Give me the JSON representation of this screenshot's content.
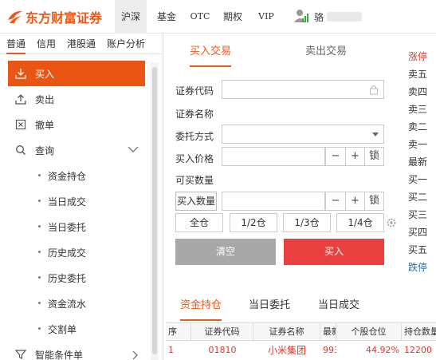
{
  "header": {
    "brand": "东方财富证券",
    "nav": [
      {
        "label": "沪深",
        "active": true
      },
      {
        "label": "基金",
        "active": false
      },
      {
        "label": "OTC",
        "active": false
      },
      {
        "label": "期权",
        "active": false
      },
      {
        "label": "VIP",
        "active": false
      }
    ],
    "user_name": "骆"
  },
  "sidebar": {
    "tabs": [
      {
        "label": "普通",
        "active": true
      },
      {
        "label": "信用",
        "active": false
      },
      {
        "label": "港股通",
        "active": false
      },
      {
        "label": "账户分析",
        "active": false
      }
    ],
    "menu": [
      {
        "label": "买入",
        "icon": "download-icon",
        "active": true
      },
      {
        "label": "卖出",
        "icon": "upload-icon",
        "active": false
      },
      {
        "label": "撤单",
        "icon": "cancel-box-icon",
        "active": false
      },
      {
        "label": "查询",
        "icon": "search-icon",
        "active": false
      },
      {
        "label": "资金持仓"
      },
      {
        "label": "当日成交"
      },
      {
        "label": "当日委托"
      },
      {
        "label": "历史成交"
      },
      {
        "label": "历史委托"
      },
      {
        "label": "资金流水"
      },
      {
        "label": "交割单"
      },
      {
        "label": "智能条件单",
        "icon": "filter-icon"
      }
    ]
  },
  "trade": {
    "tabs": {
      "buy": "买入交易",
      "sell": "卖出交易"
    },
    "labels": {
      "code": "证券代码",
      "name": "证券名称",
      "order_type": "委托方式",
      "price": "买入价格",
      "available": "可买数量"
    },
    "code_value": "",
    "order_type_value": "",
    "price_value": "",
    "qty_value": "",
    "minus": "−",
    "plus": "+",
    "lock": "锁",
    "qty_button": "买入数量",
    "positions": [
      "全仓",
      "1/2仓",
      "1/3仓",
      "1/4仓"
    ],
    "clear": "清空",
    "submit": "买入"
  },
  "order_book": {
    "labels": [
      "涨停",
      "卖五",
      "卖四",
      "卖三",
      "卖二",
      "卖一",
      "最新",
      "买一",
      "买二",
      "买三",
      "买四",
      "买五",
      "跌停"
    ]
  },
  "bottom": {
    "tabs": [
      {
        "label": "资金持仓",
        "active": true
      },
      {
        "label": "当日委托",
        "active": false
      },
      {
        "label": "当日成交",
        "active": false
      }
    ],
    "columns": [
      "序",
      "证券代码",
      "证券名称",
      "最新价",
      "个股仓位",
      "持仓数量"
    ],
    "rows": [
      [
        "1",
        "01810",
        "小米集团",
        "993",
        "44.92%",
        "12200"
      ]
    ]
  },
  "colors": {
    "accent": "#ea5514",
    "buy": "#e8413f",
    "up": "#d73a2a",
    "down": "#1f6fa6"
  }
}
